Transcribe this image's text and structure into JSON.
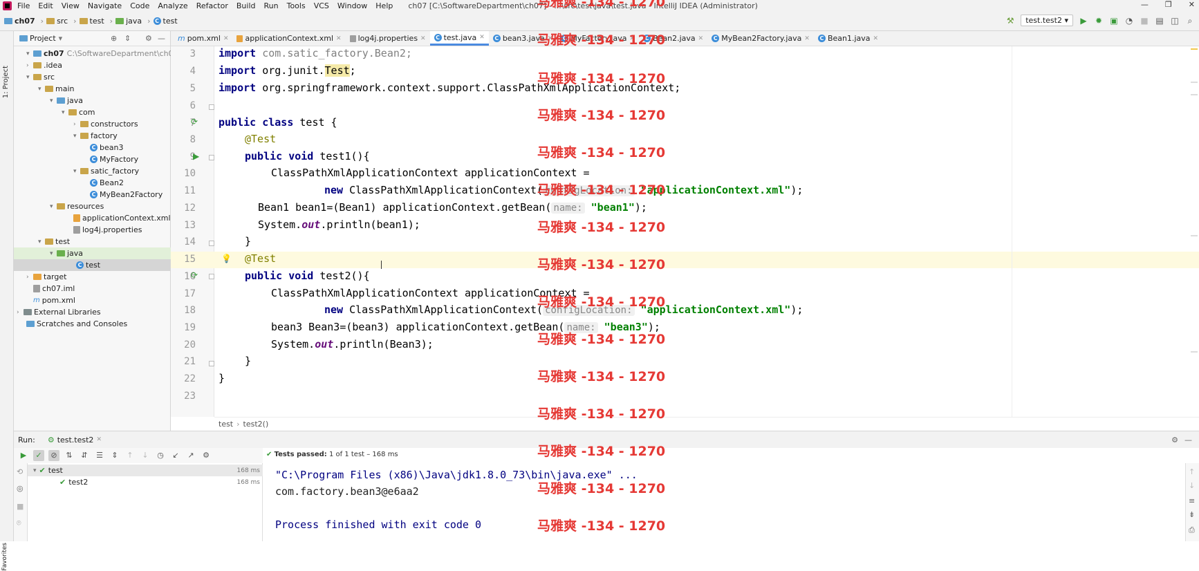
{
  "menubar": {
    "items": [
      "File",
      "Edit",
      "View",
      "Navigate",
      "Code",
      "Analyze",
      "Refactor",
      "Build",
      "Run",
      "Tools",
      "VCS",
      "Window",
      "Help"
    ],
    "window_title": "ch07 [C:\\SoftwareDepartment\\ch07] - ...\\src\\test\\java\\test.java - IntelliJ IDEA (Administrator)"
  },
  "navbar": {
    "crumbs": [
      "ch07",
      "src",
      "test",
      "java",
      "test"
    ],
    "run_config": "test.test2"
  },
  "project_panel": {
    "title": "Project",
    "strip_label": "1: Project",
    "tree": [
      {
        "label": "ch07",
        "extra": "C:\\SoftwareDepartment\\ch07"
      },
      {
        "label": ".idea"
      },
      {
        "label": "src"
      },
      {
        "label": "main"
      },
      {
        "label": "java"
      },
      {
        "label": "com"
      },
      {
        "label": "constructors"
      },
      {
        "label": "factory"
      },
      {
        "label": "bean3"
      },
      {
        "label": "MyFactory"
      },
      {
        "label": "satic_factory"
      },
      {
        "label": "Bean2"
      },
      {
        "label": "MyBean2Factory"
      },
      {
        "label": "resources"
      },
      {
        "label": "applicationContext.xml"
      },
      {
        "label": "log4j.properties"
      },
      {
        "label": "test"
      },
      {
        "label": "java"
      },
      {
        "label": "test"
      },
      {
        "label": "target"
      },
      {
        "label": "ch07.iml"
      },
      {
        "label": "pom.xml"
      },
      {
        "label": "External Libraries"
      },
      {
        "label": "Scratches and Consoles"
      }
    ]
  },
  "editor_tabs": [
    "pom.xml",
    "applicationContext.xml",
    "log4j.properties",
    "test.java",
    "bean3.java",
    "MyFactory.java",
    "Bean2.java",
    "MyBean2Factory.java",
    "Bean1.java"
  ],
  "code": {
    "line_numbers": [
      "3",
      "4",
      "5",
      "6",
      "7",
      "8",
      "9",
      "10",
      "11",
      "12",
      "13",
      "14",
      "15",
      "16",
      "17",
      "18",
      "19",
      "20",
      "21",
      "22",
      "23"
    ],
    "l3_kw": "import ",
    "l3_rest": "com.satic_factory.Bean2;",
    "l4_kw": "import ",
    "l4_a": "org.junit.",
    "l4_b": "Test",
    "l4_c": ";",
    "l5_kw": "import ",
    "l5_rest": "org.springframework.context.support.ClassPathXmlApplicationContext;",
    "l7_kw": "public class ",
    "l7_rest": "test {",
    "l8": "@Test",
    "l9_kw": "public void ",
    "l9_rest": "test1(){",
    "l10": "ClassPathXmlApplicationContext applicationContext =",
    "l11_kw": "new ",
    "l11_a": "ClassPathXmlApplicationContext(",
    "l11_hint": "configLocation:",
    "l11_str": "\"applicationContext.xml\"",
    "l11_end": ");",
    "l12_a": "Bean1 bean1=(Bean1) applicationContext.getBean(",
    "l12_hint": "name:",
    "l12_str": "\"bean1\"",
    "l12_end": ");",
    "l13_a": "System.",
    "l13_it": "out",
    "l13_b": ".println(bean1);",
    "l14": "}",
    "l15": "@Test",
    "l16_kw": "public void ",
    "l16_rest": "test2(){",
    "l17": "ClassPathXmlApplicationContext applicationContext =",
    "l18_kw": "new ",
    "l18_a": "ClassPathXmlApplicationContext(",
    "l18_hint": "configLocation:",
    "l18_str": "\"applicationContext.xml\"",
    "l18_end": ");",
    "l19_a": "bean3 Bean3=(bean3) applicationContext.getBean(",
    "l19_hint": "name:",
    "l19_str": "\"bean3\"",
    "l19_end": ");",
    "l20_a": "System.",
    "l20_it": "out",
    "l20_b": ".println(Bean3);",
    "l21": "}",
    "l22": "}"
  },
  "editor_breadcrumb": [
    "test",
    "test2()"
  ],
  "run": {
    "label": "Run:",
    "tab": "test.test2",
    "tests_passed_bold": "Tests passed:",
    "tests_passed_rest": "1 of 1 test – 168 ms",
    "tree": [
      {
        "label": "test",
        "ms": "168 ms"
      },
      {
        "label": "test2",
        "ms": "168 ms"
      }
    ],
    "console": [
      "\"C:\\Program Files (x86)\\Java\\jdk1.8.0_73\\bin\\java.exe\" ...",
      "com.factory.bean3@e6aa2",
      "",
      "Process finished with exit code 0"
    ],
    "favorites_label": "Favorites"
  },
  "watermark": "马雅爽 -134 - 1270",
  "colors": {
    "accent": "#4b8be0",
    "keyword": "#000080",
    "string": "#008000",
    "annotation": "#808000",
    "watermark": "#e53935"
  }
}
